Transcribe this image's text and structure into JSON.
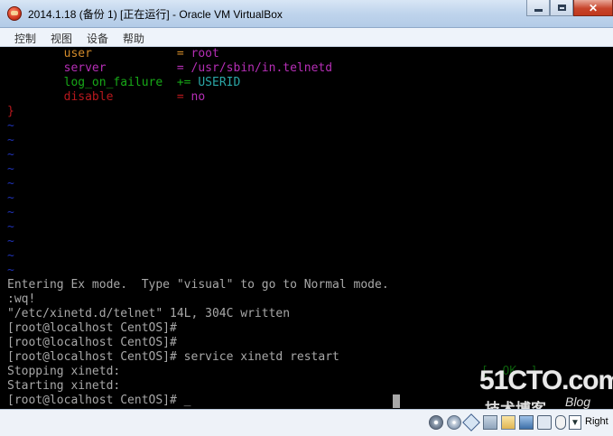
{
  "window": {
    "title": "2014.1.18 (备份 1) [正在运行] - Oracle VM VirtualBox",
    "minimize_glyph": "",
    "close_glyph": "✕"
  },
  "menu": [
    "控制",
    "视图",
    "设备",
    "帮助"
  ],
  "terminal": {
    "config_lines": [
      {
        "key": "user",
        "op": "=",
        "value": "root"
      },
      {
        "key": "server",
        "op": "=",
        "value": "/usr/sbin/in.telnetd"
      },
      {
        "key": "log_on_failure",
        "op": "+=",
        "value": "USERID"
      },
      {
        "key": "disable",
        "op": "=",
        "value": "no"
      }
    ],
    "closing_brace": "}",
    "tilde": "~",
    "output_lines": [
      "Entering Ex mode.  Type \"visual\" to go to Normal mode.",
      ":wq!",
      "\"/etc/xinetd.d/telnet\" 14L, 304C written",
      "[root@localhost CentOS]#",
      "[root@localhost CentOS]#",
      "[root@localhost CentOS]# service xinetd restart",
      "Stopping xinetd:",
      "Starting xinetd:",
      "[root@localhost CentOS]# _"
    ],
    "status_ok_partial": "[  OK  ]"
  },
  "watermark": {
    "main": "51CTO.com",
    "sub": "技术博客",
    "blog": "Blog"
  },
  "statusbar": {
    "host_key": "Right"
  },
  "colors": {
    "key_user": "#d38b2a",
    "key_log": "#17a817",
    "key_disable": "#b8181d",
    "value_magenta": "#b52eb5",
    "value_cyan": "#2aa6a6",
    "tilde_blue": "#1f32b5",
    "terminal_text": "#a8a8a8"
  }
}
